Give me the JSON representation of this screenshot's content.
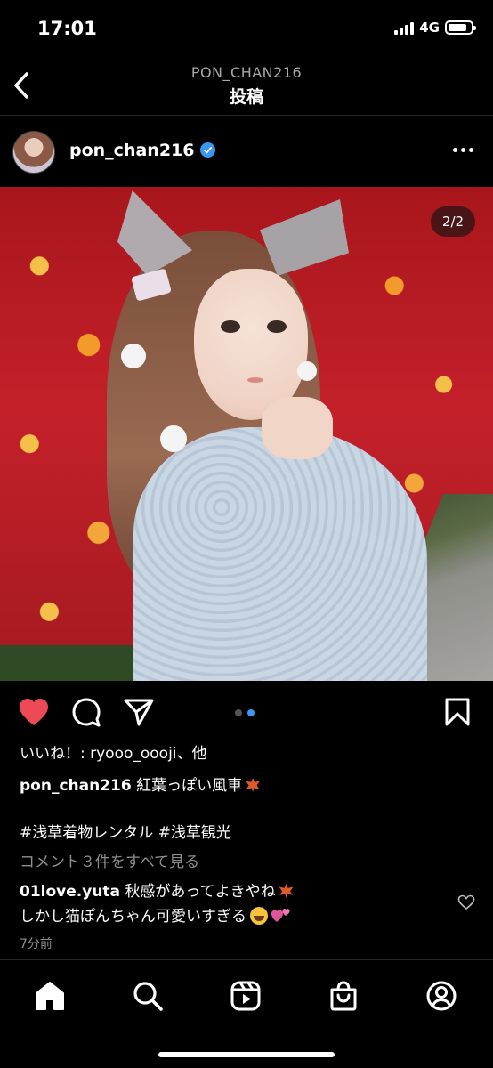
{
  "status_bar": {
    "time": "17:01",
    "network": "4G",
    "battery_level": 0.85
  },
  "header": {
    "subtitle": "PON_CHAN216",
    "title": "投稿"
  },
  "post": {
    "username": "pon_chan216",
    "verified": true,
    "image_counter": "2/2",
    "carousel": {
      "count": 2,
      "active_index": 1
    },
    "likes_text": "いいね！: ryooo_oooji、他",
    "caption_user": "pon_chan216",
    "caption_text": "紅葉っぽい風車",
    "hashtags": "#浅草着物レンタル #浅草観光",
    "view_comments": "コメント３件をすべて見る",
    "comment": {
      "user": "01love.yuta",
      "line1": "秋感があってよきやね",
      "line2": "しかし猫ぽんちゃん可愛いすぎる"
    },
    "timestamp": "7分前"
  },
  "icons": {
    "like": "heart-filled-icon",
    "comment": "comment-icon",
    "share": "send-icon",
    "save": "bookmark-icon",
    "tabs": [
      "home-icon",
      "search-icon",
      "reels-icon",
      "shop-icon",
      "profile-icon"
    ]
  },
  "colors": {
    "background": "#000000",
    "like": "#ed4956",
    "verified": "#3897f0",
    "dot_active": "#3897f0",
    "dot_inactive": "#555555",
    "muted": "#8e8e8e"
  }
}
